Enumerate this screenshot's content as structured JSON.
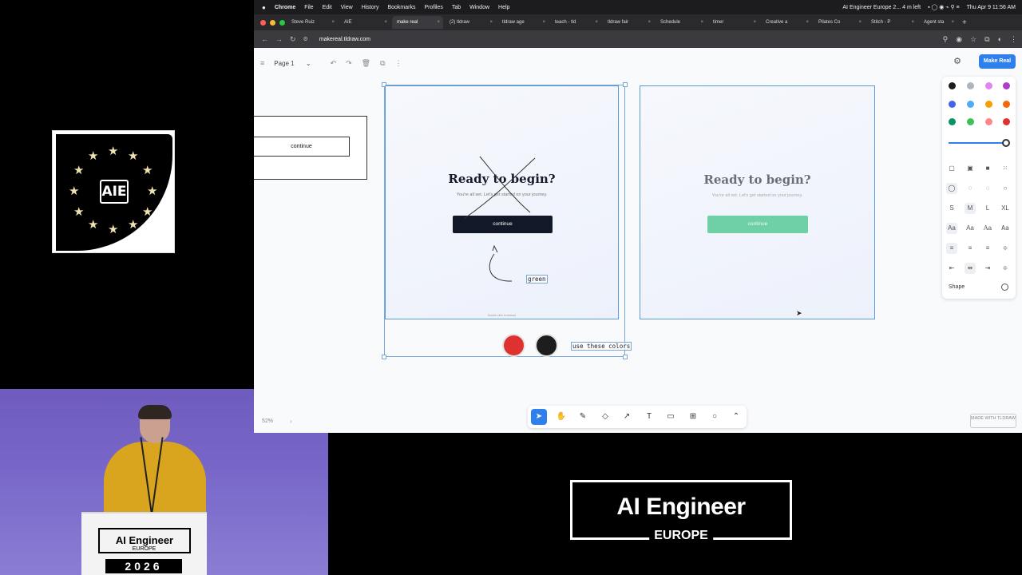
{
  "aie_card": {
    "label": "AIE"
  },
  "podium": {
    "title": "AI Engineer",
    "subtitle": "EUROPE",
    "year": "2026"
  },
  "big_logo": {
    "title": "AI Engineer",
    "subtitle": "EUROPE"
  },
  "mac_menu": {
    "items": [
      "Chrome",
      "File",
      "Edit",
      "View",
      "History",
      "Bookmarks",
      "Profiles",
      "Tab",
      "Window",
      "Help"
    ],
    "status": "AI Engineer Europe 2... 4 m left",
    "clock": "Thu Apr 9 11:56 AM"
  },
  "tabs": [
    {
      "label": "Steve Ruiz"
    },
    {
      "label": "AIE"
    },
    {
      "label": "make real"
    },
    {
      "label": "(2) tldraw"
    },
    {
      "label": "tldraw age"
    },
    {
      "label": "teach - tld"
    },
    {
      "label": "tldraw fair"
    },
    {
      "label": "Schedule"
    },
    {
      "label": "timer"
    },
    {
      "label": "Creative a"
    },
    {
      "label": "Pilates Co"
    },
    {
      "label": "Stitch - P"
    },
    {
      "label": "Agent sta"
    }
  ],
  "address": {
    "url": "makereal.tldraw.com"
  },
  "tldraw": {
    "page_name": "Page 1",
    "make_real": "Make Real",
    "zoom": "52%",
    "made_with": "MADE WITH TLDRAW",
    "style_panel": {
      "sizes": [
        "S",
        "M",
        "L",
        "XL"
      ],
      "fonts": [
        "Aa",
        "Aa",
        "Aa",
        "Aa"
      ],
      "shape_label": "Shape",
      "colors": [
        "#1d1d1d",
        "#adb5bd",
        "#e085f4",
        "#ae3ec9",
        "#4263eb",
        "#4dabf7",
        "#f59f00",
        "#f76707",
        "#099268",
        "#40c057",
        "#ff8787",
        "#e03131"
      ]
    }
  },
  "canvas": {
    "left_button": "continue",
    "frame1": {
      "title": "Ready to begin?",
      "subtitle": "You're all set. Let's get started on your journey.",
      "button": "continue",
      "footer": "Double click to interact",
      "annotation": "green"
    },
    "frame2": {
      "title": "Ready to begin?",
      "subtitle": "You're all set. Let's get started on your journey.",
      "button": "continue"
    },
    "note": "use these colors",
    "dot_colors": [
      "#e03131",
      "#1d1d1d"
    ],
    "button_green": "#6fd0a5"
  }
}
